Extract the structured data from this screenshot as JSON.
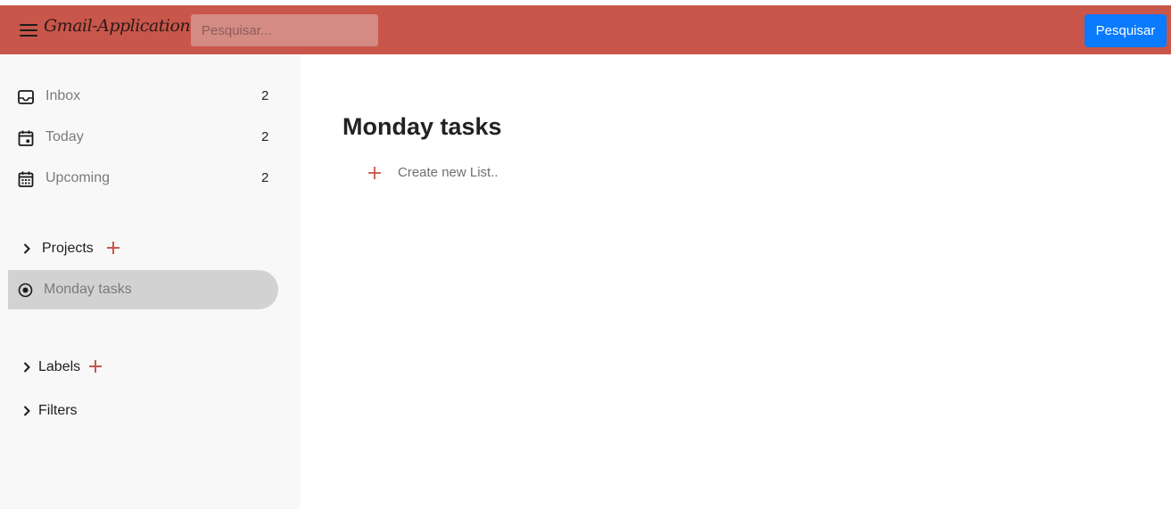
{
  "header": {
    "app_title": "Gmail-Application",
    "search_placeholder": "Pesquisar...",
    "search_button_label": "Pesquisar",
    "colors": {
      "header_bg": "#c9564a",
      "button_bg": "#0a7bff"
    }
  },
  "sidebar": {
    "items": [
      {
        "label": "Inbox",
        "count": "2",
        "icon": "inbox-icon"
      },
      {
        "label": "Today",
        "count": "2",
        "icon": "calendar-today-icon"
      },
      {
        "label": "Upcoming",
        "count": "2",
        "icon": "calendar-upcoming-icon"
      }
    ],
    "projects": {
      "label": "Projects",
      "items": [
        {
          "label": "Monday tasks",
          "icon": "radio-circle-icon",
          "selected": true
        }
      ]
    },
    "labels": {
      "label": "Labels"
    },
    "filters": {
      "label": "Filters"
    }
  },
  "main": {
    "title": "Monday tasks",
    "create_list_label": "Create new List.."
  },
  "colors": {
    "accent_plus": "#c9564a",
    "sidebar_bg": "#f8f8f8",
    "selected_bg": "#d2d2d2"
  }
}
